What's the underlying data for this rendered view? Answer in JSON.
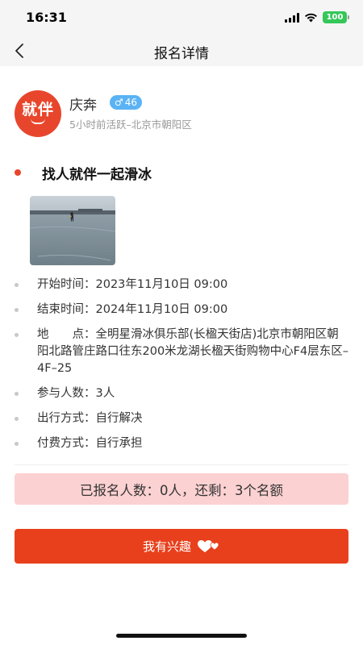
{
  "status_bar": {
    "time": "16:31",
    "battery": "100"
  },
  "nav": {
    "title": "报名详情"
  },
  "user": {
    "avatar_text": "就伴",
    "name": "庆奔",
    "gender_symbol": "♂",
    "age": "46",
    "meta": "5小时前活跃–北京市朝阳区"
  },
  "activity": {
    "title": "找人就伴一起滑冰",
    "details": [
      {
        "label": "开始时间：",
        "value": "2023年11月10日 09:00"
      },
      {
        "label": "结束时间：",
        "value": "2024年11月10日 09:00"
      },
      {
        "label": "地　　点：",
        "value": "全明星滑冰俱乐部(长楹天街店)北京市朝阳区朝阳北路管庄路口往东200米龙湖长楹天街购物中心F4层东区–4F–25"
      },
      {
        "label": "参与人数：",
        "value": "3人"
      },
      {
        "label": "出行方式：",
        "value": "自行解决"
      },
      {
        "label": "付费方式：",
        "value": "自行承担"
      }
    ]
  },
  "quota": {
    "text": "已报名人数：0人，还剩：3个名额"
  },
  "actions": {
    "interest_label": "我有兴趣"
  },
  "colors": {
    "accent": "#e8401c",
    "banner_bg": "#fcd1d2",
    "badge_blue": "#5ab3f4"
  }
}
